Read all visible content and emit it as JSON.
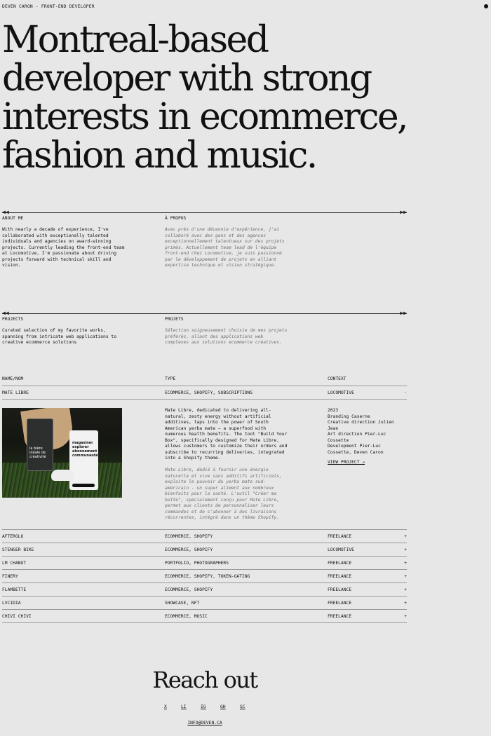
{
  "header": {
    "title": "DEVEN CARON - FRONT-END DEVELOPER"
  },
  "hero": {
    "text": "Montreal-based developer with strong interests in ecommerce, fashion and music."
  },
  "about": {
    "label_en": "ABOUT ME",
    "label_fr": "À PROPOS",
    "text_en": "With nearly a decade of experience, I've collaborated with exceptionally talented individuals and agencies on award-winning projects. Currently leading the front-end team at Locomotive, I'm passionate about driving projects forward with technical skill and vision.",
    "text_fr": "Avec près d'une décennie d'expérience, j'ai collaboré avec des gens et des agences exceptionnellement talentueux sur des projets primés. Actuellement team lead de l'équipe front-end chez Locomotive, je suis passionné par le développement de projets en alliant expertise technique et vision stratégique."
  },
  "projects_intro": {
    "label_en": "PROJECTS",
    "label_fr": "PROJETS",
    "text_en": "Curated selection of my favorite works, spanning from intricate web applications to creative ecommerce solutions",
    "text_fr": "Sélection soigneusement choisie de mes projets préférés, allant des applications web complexes aux solutions ecommerce créatives."
  },
  "table": {
    "headers": {
      "name": "NAME/NOM",
      "type": "TYPE",
      "context": "CONTEXT"
    },
    "expanded": {
      "name": "MATE LIBRE",
      "type": "ECOMMERCE, SHOPIFY, SUBSCRIPTIONS",
      "context": "LOCOMOTIVE",
      "toggle": "-",
      "image_text_left": "la bière idéale de créativité",
      "image_text_right": "magasiner explorer abonnement communauté",
      "desc_en": "Mate Libre, dedicated to delivering all-natural, zesty energy without artificial additives, taps into the power of South American yerba mate — a superfood with numerous health benefits. The tool \"Build Your Box\", specifically designed for Mate Libre, allows customers to customize their orders and subscribe to recurring deliveries, integrated into a Shopify theme.",
      "desc_fr": "Mate Libre, dédié à fournir une énergie naturelle et vive sans additifs artificiels, exploite le pouvoir du yerba mate sud-américain - un super aliment aux nombreux bienfaits pour la santé. L'outil \"Créer ma boîte\", spécialement conçu pour Mate Libre, permet aux clients de personnaliser leurs commandes et de s'abonner à des livraisons récurrentes, intégré dans un thème Shopify.",
      "meta": [
        "2023",
        "Branding Caserne",
        "Creative direction Julien Jean",
        "Art direction Pier-Luc Cossette",
        "Development Pier-Luc Cossette, Deven Caron"
      ],
      "view_link": "VIEW PROJECT ↗"
    },
    "rows": [
      {
        "name": "AFTERGLO",
        "type": "ECOMMERCE, SHOPIFY",
        "context": "FREELANCE",
        "toggle": "+"
      },
      {
        "name": "STENGER BIKE",
        "type": "ECOMMERCE, SHOPIFY",
        "context": "LOCOMOTIVE",
        "toggle": "+"
      },
      {
        "name": "LM CHABOT",
        "type": "PORTFOLIO, PHOTOGRAPHERS",
        "context": "FREELANCE",
        "toggle": "+"
      },
      {
        "name": "FINERY",
        "type": "ECOMMERCE, SHOPIFY, TOKEN-GATING",
        "context": "FREELANCE",
        "toggle": "+"
      },
      {
        "name": "FLAMBETTE",
        "type": "ECOMMERCE, SHOPIFY",
        "context": "FREELANCE",
        "toggle": "+"
      },
      {
        "name": "LVCIDIA",
        "type": "SHOWCASE, NFT",
        "context": "FREELANCE",
        "toggle": "+"
      },
      {
        "name": "CHIVI CHIVI",
        "type": "ECOMMERCE, MUSIC",
        "context": "FREELANCE",
        "toggle": "+"
      }
    ]
  },
  "footer": {
    "title": "Reach out",
    "socials": [
      "X",
      "LI",
      "IG",
      "GH",
      "SC"
    ],
    "email": "INFO@DEVEN.CA"
  }
}
